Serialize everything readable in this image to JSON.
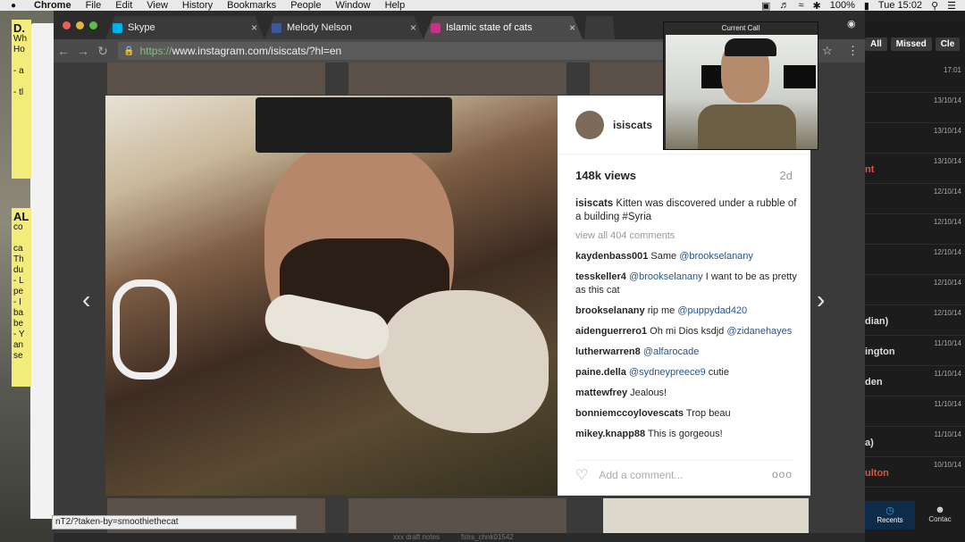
{
  "menubar": {
    "app": "Chrome",
    "items": [
      "File",
      "Edit",
      "View",
      "History",
      "Bookmarks",
      "People",
      "Window",
      "Help"
    ],
    "battery": "100%",
    "clock": "Tue 15:02"
  },
  "sticky_notes": {
    "note1_title": "D.",
    "note1_lines": [
      "Wh",
      "Ho",
      "- a",
      "- tl"
    ],
    "note2_title": "AL",
    "note2_lines": [
      "co",
      "ca",
      "Th",
      "du",
      "- L",
      "pe",
      "- I",
      "ba",
      "be",
      "- Y",
      "an",
      "se"
    ]
  },
  "browser": {
    "tabs": [
      {
        "title": "Skype",
        "favicon_color": "#00aff0",
        "close": "×"
      },
      {
        "title": "Melody Nelson",
        "favicon_color": "#3b5998",
        "close": "×"
      },
      {
        "title": "Islamic state of cats",
        "favicon_color": "#c13584",
        "close": "×"
      }
    ],
    "url_https": "https://",
    "url_rest": "www.instagram.com/isiscats/?hl=en",
    "status_url": "nT2/?taken-by=smoothiethecat"
  },
  "post": {
    "username": "isiscats",
    "views": "148k views",
    "age": "2d",
    "caption_user": "isiscats",
    "caption_text": "Kitten was discovered under a rubble of a building #Syria",
    "view_all": "view all 404 comments",
    "comments": [
      {
        "user": "kaydenbass001",
        "text": "Same ",
        "mention": "@brookselanany"
      },
      {
        "user": "tesskeller4",
        "mention": "@brookselanany",
        "text": " I want to be as pretty as this cat"
      },
      {
        "user": "brookselanany",
        "text": "rip me ",
        "mention": "@puppydad420"
      },
      {
        "user": "aidenguerrero1",
        "text": "Oh mi Dios ksdjd ",
        "mention": "@zidanehayes"
      },
      {
        "user": "lutherwarren8",
        "mention": "@alfarocade",
        "text": ""
      },
      {
        "user": "paine.della",
        "mention": "@sydneypreece9",
        "text": " cutie"
      },
      {
        "user": "mattewfrey",
        "text": "Jealous!",
        "mention": ""
      },
      {
        "user": "bonniemccoylovescats",
        "text": "Trop beau",
        "mention": ""
      },
      {
        "user": "mikey.knapp88",
        "text": "This is gorgeous!",
        "mention": ""
      }
    ],
    "add_comment_placeholder": "Add a comment...",
    "more": "ooo"
  },
  "call": {
    "label": "Current Call"
  },
  "skype": {
    "tabs": [
      "All",
      "Missed",
      "Cle"
    ],
    "rows": [
      {
        "name": "",
        "date": "17:01",
        "red": false
      },
      {
        "name": "",
        "date": "13/10/14",
        "red": false
      },
      {
        "name": "",
        "date": "13/10/14",
        "red": false
      },
      {
        "name": "nt",
        "date": "13/10/14",
        "red": true
      },
      {
        "name": "",
        "date": "12/10/14",
        "red": false
      },
      {
        "name": "",
        "date": "12/10/14",
        "red": false
      },
      {
        "name": "",
        "date": "12/10/14",
        "red": false
      },
      {
        "name": "",
        "date": "12/10/14",
        "red": false
      },
      {
        "name": "dian)",
        "date": "12/10/14",
        "red": false
      },
      {
        "name": "ington",
        "date": "11/10/14",
        "red": false
      },
      {
        "name": "den",
        "date": "11/10/14",
        "red": false
      },
      {
        "name": "",
        "date": "11/10/14",
        "red": false
      },
      {
        "name": "a)",
        "date": "11/10/14",
        "red": false
      },
      {
        "name": "ulton",
        "date": "10/10/14",
        "red": true
      }
    ],
    "recents": "Recents",
    "contacts": "Contac"
  },
  "dock": {
    "items": [
      "xxx draft notes",
      "fstrs_chnk01542"
    ]
  }
}
